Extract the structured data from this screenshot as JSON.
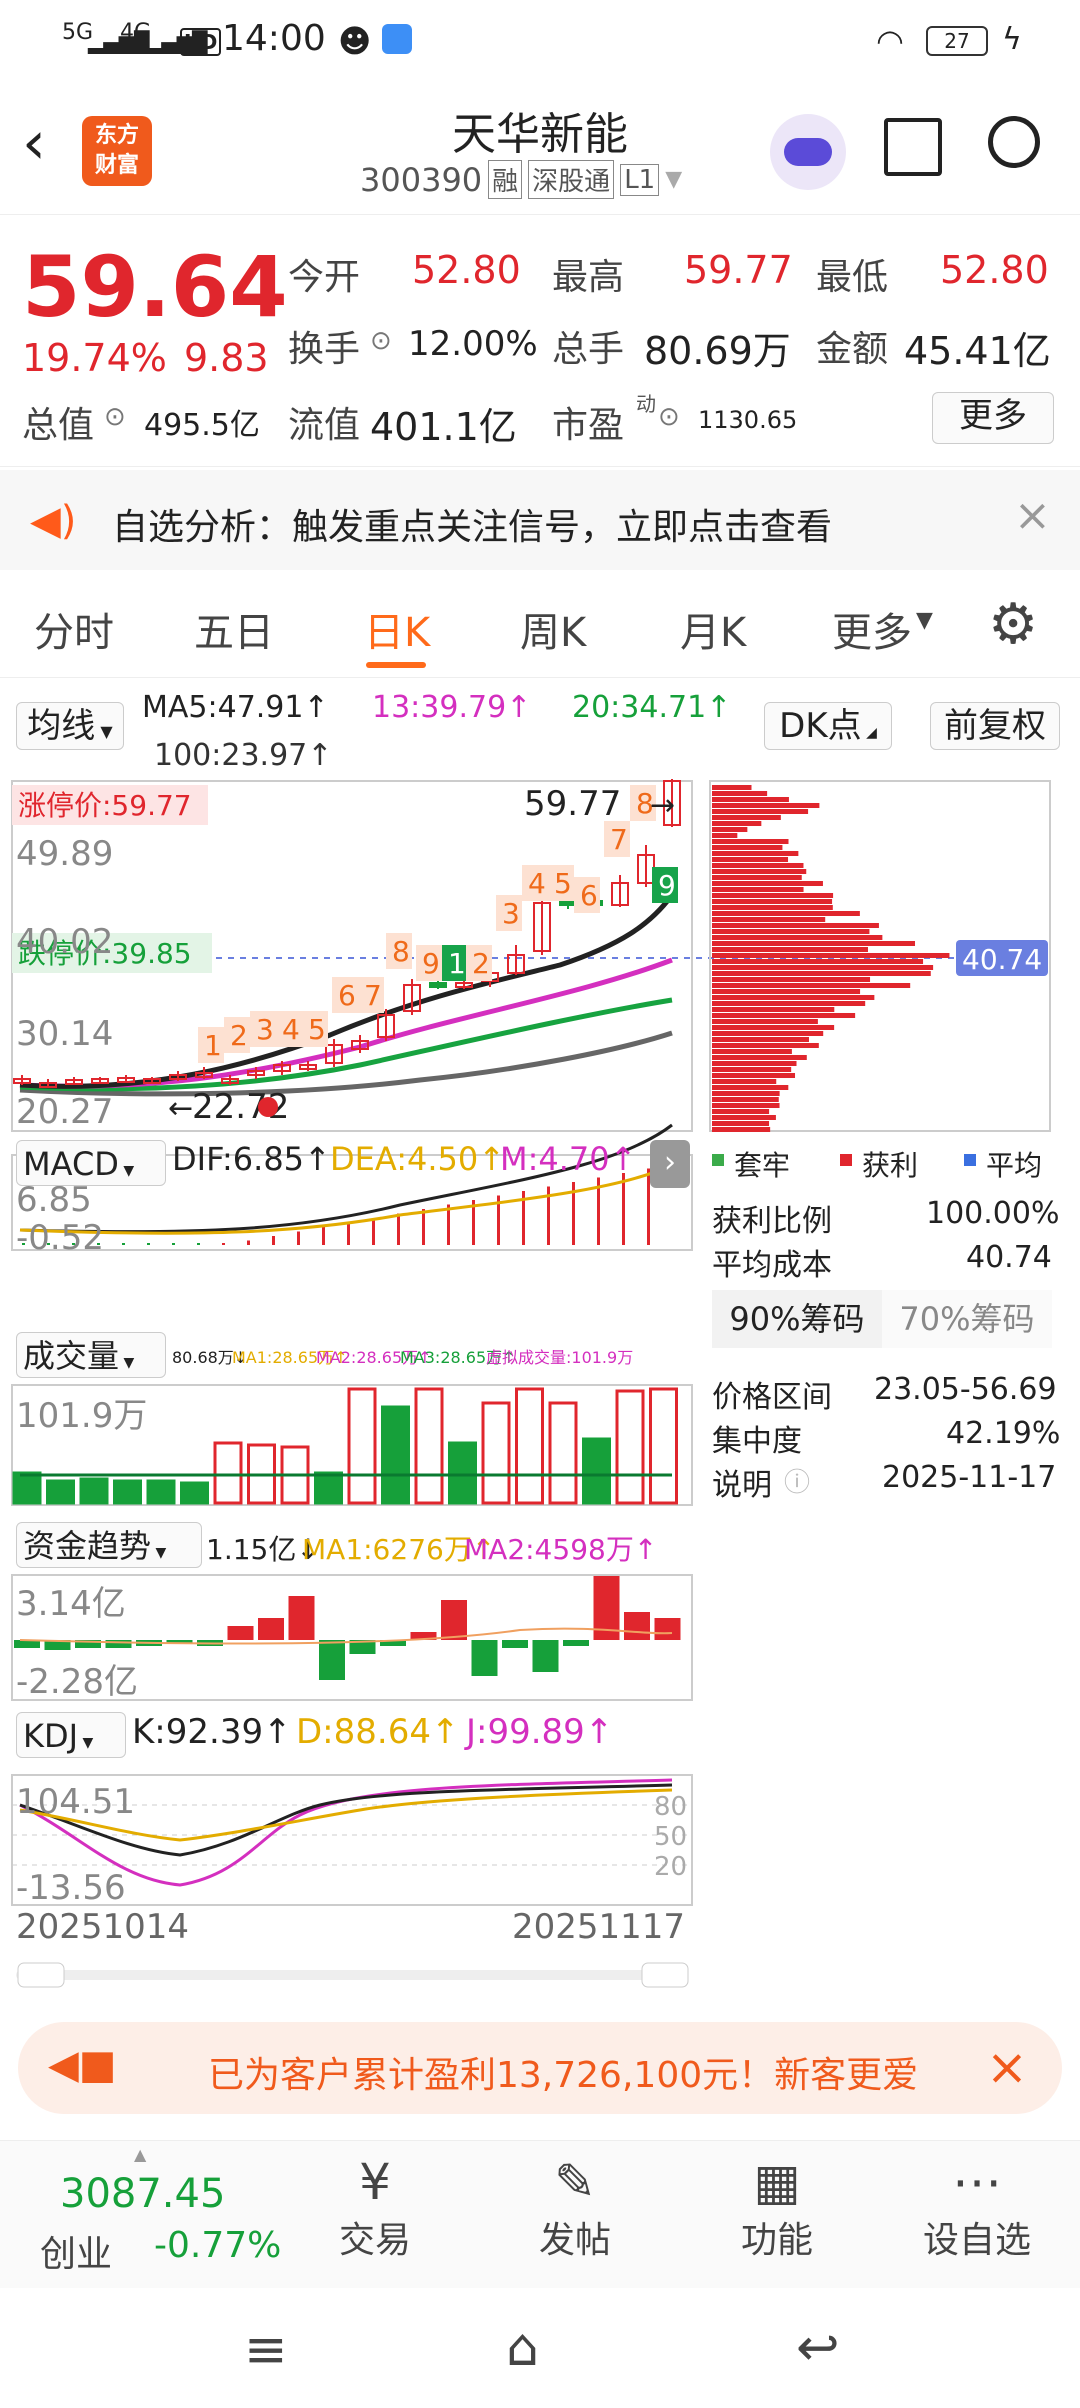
{
  "status": {
    "network": "5G",
    "network2": "4G",
    "hd": "HD",
    "time": "14:00",
    "battery": "27"
  },
  "header": {
    "logo_line1": "东方",
    "logo_line2": "财富",
    "title": "天华新能",
    "code": "300390",
    "tags": [
      "融",
      "深股通",
      "L1"
    ]
  },
  "quote": {
    "price": "59.64",
    "change_pct": "19.74%",
    "change": "9.83",
    "open_label": "今开",
    "open": "52.80",
    "high_label": "最高",
    "high": "59.77",
    "low_label": "最低",
    "low": "52.80",
    "turnover_label": "换手",
    "turnover": "12.00%",
    "volume_label": "总手",
    "volume": "80.69万",
    "amount_label": "金额",
    "amount": "45.41亿",
    "mktcap_label": "总值",
    "mktcap": "495.5亿",
    "float_label": "流值",
    "float": "401.1亿",
    "pe_label": "市盈",
    "pe_sup": "动",
    "pe": "1130.65",
    "more_label": "更多"
  },
  "alert": {
    "text": "自选分析：触发重点关注信号，立即点击查看"
  },
  "tabs": [
    "分时",
    "五日",
    "日K",
    "周K",
    "月K",
    "更多"
  ],
  "active_tab": "日K",
  "ma_bar": {
    "selector": "均线",
    "ma5": "MA5:47.91↑",
    "ma13": "13:39.79↑",
    "ma20": "20:34.71↑",
    "ma100": "100:23.97↑",
    "dk": "DK点",
    "adj": "前复权"
  },
  "kchart": {
    "limit_up": "涨停价:59.77",
    "limit_down": "跌停价:39.85",
    "y_high": "49.89",
    "y_mid": "40.02",
    "y_low": "30.14",
    "y_min": "20.27",
    "max_label": "59.77",
    "min_label": "22.72",
    "cost_label": "40.74",
    "seq_numbers": [
      "1",
      "2",
      "3",
      "4",
      "5",
      "6",
      "7",
      "8",
      "9",
      "1",
      "2",
      "3",
      "4",
      "5",
      "6",
      "7",
      "8",
      "9"
    ]
  },
  "chips": {
    "legend": [
      "套牢",
      "获利",
      "平均"
    ],
    "profit_ratio_label": "获利比例",
    "profit_ratio": "100.00%",
    "avg_cost_label": "平均成本",
    "avg_cost": "40.74",
    "tab90": "90%筹码",
    "tab70": "70%筹码",
    "range_label": "价格区间",
    "range": "23.05-56.69",
    "conc_label": "集中度",
    "conc": "42.19%",
    "note_label": "说明",
    "note_date": "2025-11-17"
  },
  "macd": {
    "name": "MACD",
    "dif": "DIF:6.85↑",
    "dea": "DEA:4.50↑",
    "m": "M:4.70↑",
    "y_top": "6.85",
    "y_bot": "-0.52"
  },
  "volume": {
    "name": "成交量",
    "line": "80.68万↓",
    "ma1": "MA1:28.65万↑",
    "ma2": "MA2:28.65万↑",
    "ma3": "MA3:28.65万↑",
    "virtual": "虚拟成交量:101.9万",
    "y_top": "101.9万"
  },
  "fund": {
    "name": "资金趋势",
    "value": "1.15亿↓",
    "ma1": "MA1:6276万↑",
    "ma2": "MA2:4598万↑",
    "y_top": "3.14亿",
    "y_bot": "-2.28亿"
  },
  "kdj": {
    "name": "KDJ",
    "k": "K:92.39↑",
    "d": "D:88.64↑",
    "j": "J:99.89↑",
    "y_top": "104.51",
    "y_bot": "-13.56",
    "r80": "80",
    "r50": "50",
    "r20": "20"
  },
  "dates": {
    "start": "20251014",
    "end": "20251117"
  },
  "banner": {
    "text": "已为客户累计盈利13,726,100元！新客更爱"
  },
  "bottom": {
    "index_value": "3087.45",
    "index_name": "创业",
    "index_change": "-0.77%",
    "items": [
      "交易",
      "发帖",
      "功能",
      "设自选"
    ]
  },
  "colors": {
    "up": "#e0262d",
    "down": "#16a03a",
    "accent": "#ff6a1a"
  }
}
